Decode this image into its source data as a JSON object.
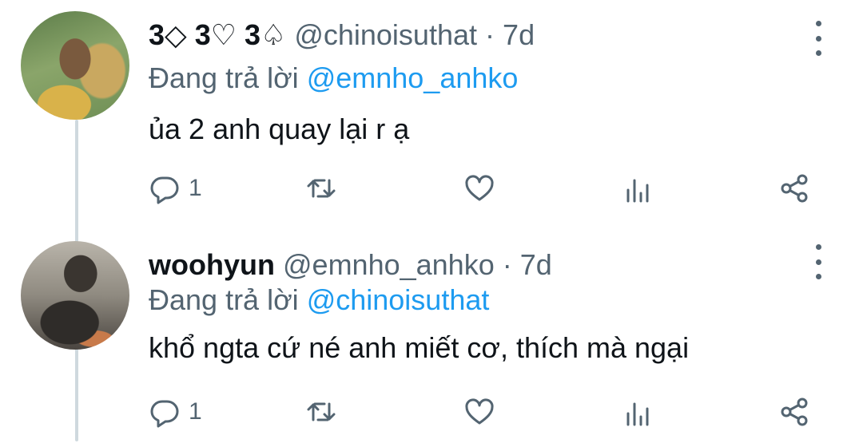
{
  "colors": {
    "accent": "#1d9bf0",
    "muted": "#536471",
    "text": "#0f1419",
    "thread_line": "#cfd9de"
  },
  "tweets": [
    {
      "display_name": "3◇ 3♡ 3♤",
      "handle": "@chinoisuthat",
      "separator": "·",
      "time": "7d",
      "reply_prefix": "Đang trả lời ",
      "reply_to": "@emnho_anhko",
      "text": "ủa 2 anh quay lại r ạ",
      "reply_count": "1",
      "icons": [
        "reply-icon",
        "retweet-icon",
        "like-icon",
        "views-icon",
        "share-icon",
        "more-icon"
      ]
    },
    {
      "display_name": "woohyun",
      "handle": "@emnho_anhko",
      "separator": "·",
      "time": "7d",
      "reply_prefix": "Đang trả lời ",
      "reply_to": "@chinoisuthat",
      "text": "khổ ngta cứ né anh miết cơ, thích mà ngại",
      "reply_count": "1",
      "icons": [
        "reply-icon",
        "retweet-icon",
        "like-icon",
        "views-icon",
        "share-icon",
        "more-icon"
      ]
    }
  ]
}
